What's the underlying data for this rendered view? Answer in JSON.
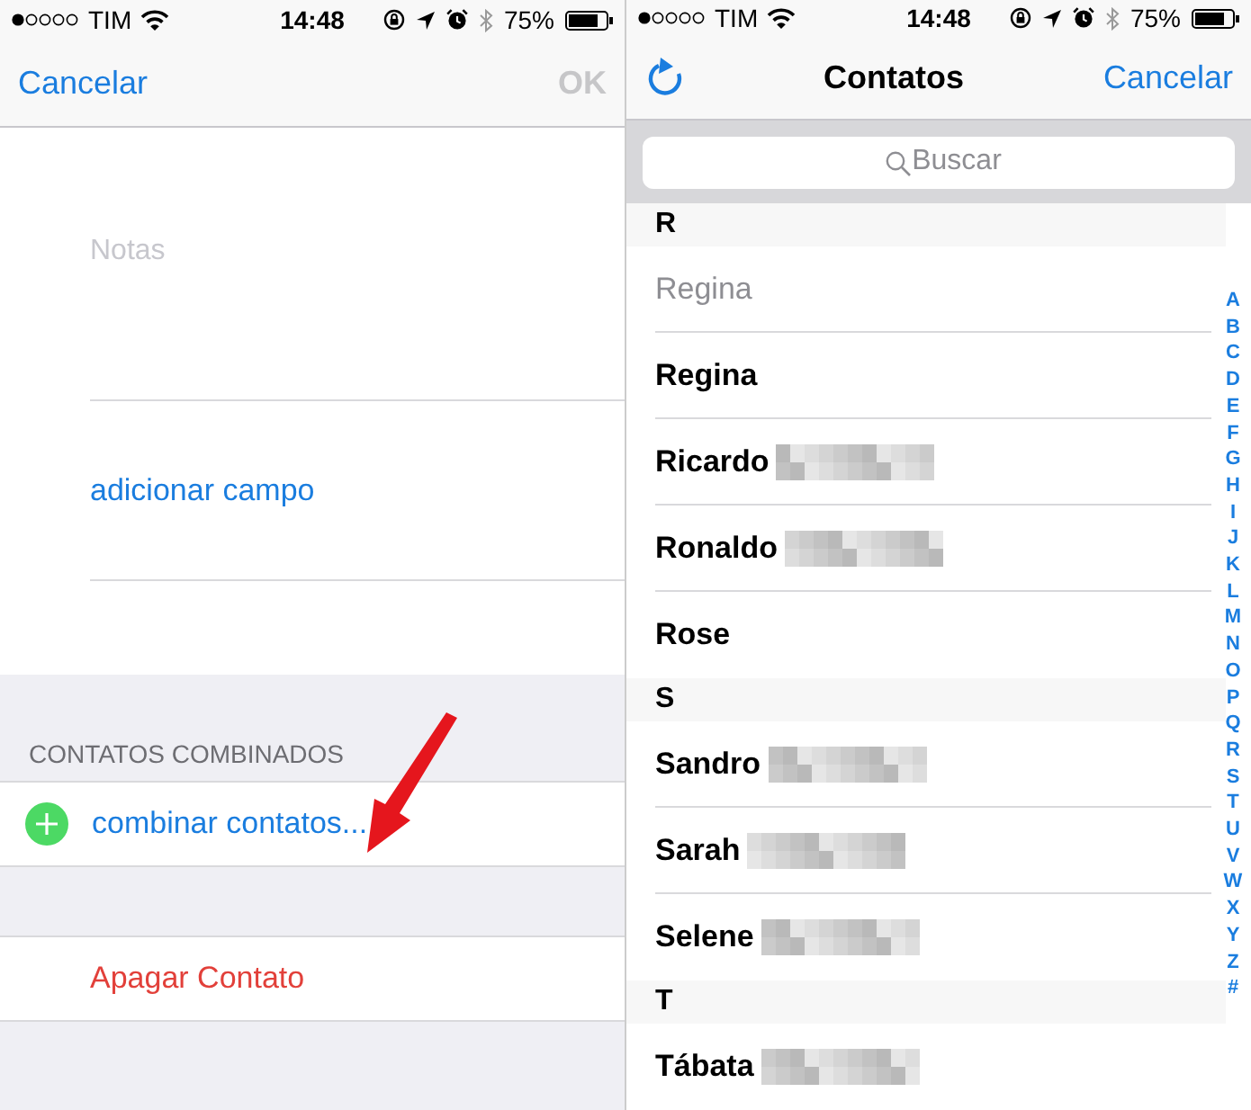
{
  "status_bars": [
    {
      "carrier": "TIM",
      "time": "14:48",
      "battery": "75%"
    },
    {
      "carrier": "TIM",
      "time": "14:48",
      "battery": "75%"
    }
  ],
  "edit_screen": {
    "cancel": "Cancelar",
    "ok": "OK",
    "ok_disabled": true,
    "notes_placeholder": "Notas",
    "add_field": "adicionar campo",
    "linked_header": "CONTATOS COMBINADOS",
    "link_action": "combinar contatos...",
    "delete_action": "Apagar Contato"
  },
  "picker": {
    "title": "Contatos",
    "cancel": "Cancelar",
    "search_placeholder": "Buscar",
    "sections": [
      {
        "letter": "R",
        "contacts": [
          {
            "name": "Regina",
            "disabled": true,
            "surname_redacted": false
          },
          {
            "name": "Regina",
            "disabled": false,
            "surname_redacted": false
          },
          {
            "name": "Ricardo",
            "disabled": false,
            "surname_redacted": true
          },
          {
            "name": "Ronaldo",
            "disabled": false,
            "surname_redacted": true
          },
          {
            "name": "Rose",
            "disabled": false,
            "surname_redacted": false
          }
        ]
      },
      {
        "letter": "S",
        "contacts": [
          {
            "name": "Sandro",
            "disabled": false,
            "surname_redacted": true
          },
          {
            "name": "Sarah",
            "disabled": false,
            "surname_redacted": true
          },
          {
            "name": "Selene",
            "disabled": false,
            "surname_redacted": true
          }
        ]
      },
      {
        "letter": "T",
        "contacts": [
          {
            "name": "Tábata",
            "disabled": false,
            "surname_redacted": true
          }
        ]
      }
    ],
    "index": [
      "A",
      "B",
      "C",
      "D",
      "E",
      "F",
      "G",
      "H",
      "I",
      "J",
      "K",
      "L",
      "M",
      "N",
      "O",
      "P",
      "Q",
      "R",
      "S",
      "T",
      "U",
      "V",
      "W",
      "X",
      "Y",
      "Z",
      "#"
    ]
  }
}
